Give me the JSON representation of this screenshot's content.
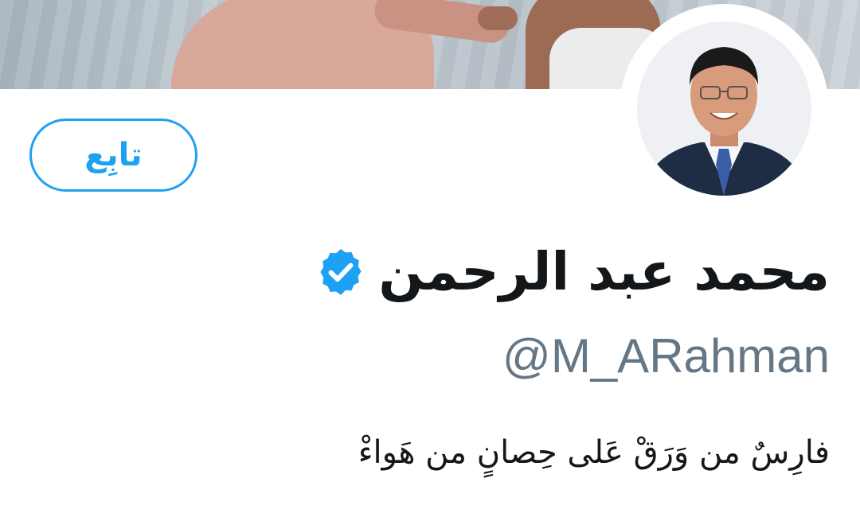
{
  "profile": {
    "display_name": "محمد عبد الرحمن",
    "handle": "@M_ARahman",
    "bio_line_1": "فارِسٌ من وَرَقْ عَلى حِصانٍ من هَواءْ",
    "verified": true
  },
  "actions": {
    "follow_label": "تابِع"
  },
  "icons": {
    "verified": "verified-badge-icon"
  },
  "colors": {
    "accent": "#1da1f2",
    "text_primary": "#14171a",
    "text_secondary": "#657786"
  }
}
